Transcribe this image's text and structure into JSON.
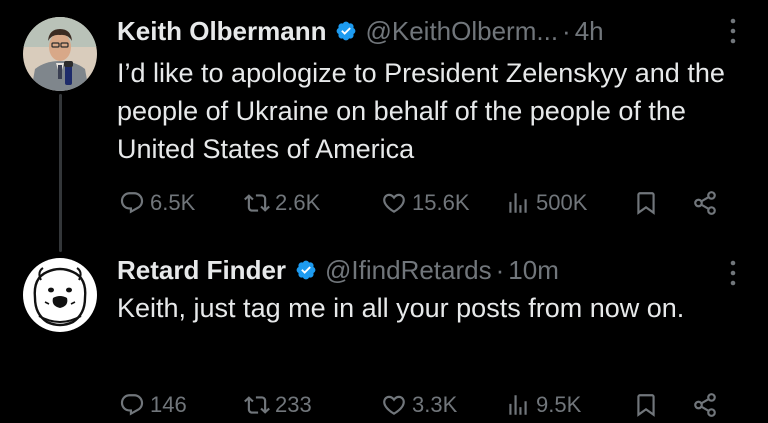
{
  "tweets": [
    {
      "display_name": "Keith Olbermann",
      "handle": "@KeithOlberm...",
      "separator": "·",
      "time": "4h",
      "text": "I’d like to apologize to President Zelenskyy and the people of Ukraine on behalf of the people of the United States of America",
      "counts": {
        "replies": "6.5K",
        "reposts": "2.6K",
        "likes": "15.6K",
        "views": "500K"
      }
    },
    {
      "display_name": "Retard Finder",
      "handle": "@IfindRetards",
      "separator": "·",
      "time": "10m",
      "text": "Keith, just tag me in all your posts from now on.",
      "counts": {
        "replies": "146",
        "reposts": "233",
        "likes": "3.3K",
        "views": "9.5K"
      }
    }
  ],
  "colors": {
    "background": "#000000",
    "text_primary": "#e7e9ea",
    "text_secondary": "#71767b",
    "verified_badge": "#1d9bf0",
    "thread_line": "#333639"
  },
  "icons": {
    "verified": "verified-badge-icon",
    "more": "more-options-icon",
    "reply": "reply-icon",
    "repost": "repost-icon",
    "like": "heart-icon",
    "views": "views-chart-icon",
    "bookmark": "bookmark-icon",
    "share": "share-icon"
  }
}
